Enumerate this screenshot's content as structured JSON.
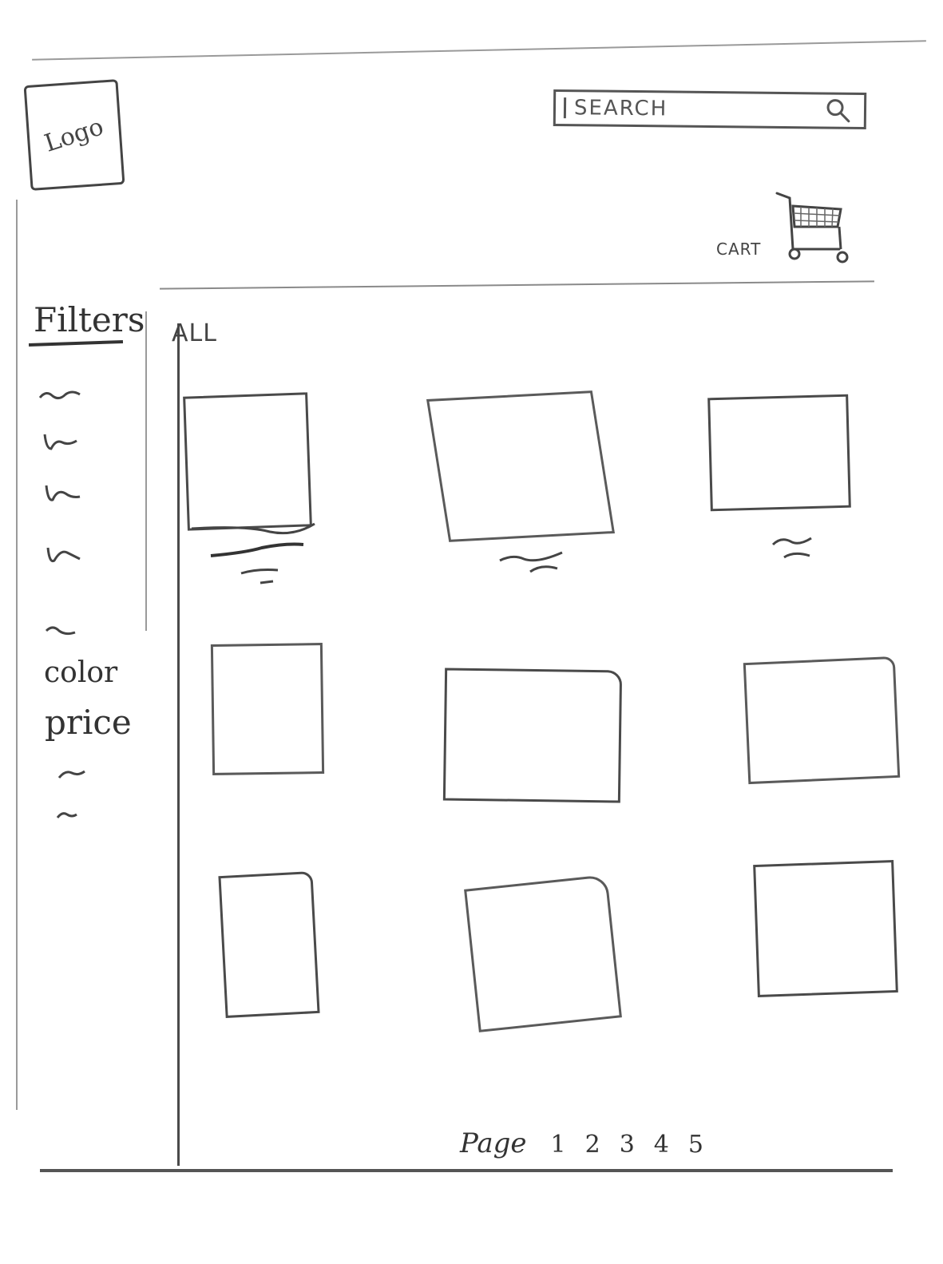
{
  "header": {
    "logo_text": "Logo",
    "search_placeholder": "SEARCH",
    "cart_label": "CART"
  },
  "sidebar": {
    "title": "Filters",
    "sections": [
      "color",
      "price"
    ]
  },
  "main": {
    "active_tab": "ALL",
    "product_count": 9
  },
  "pagination": {
    "label": "Page",
    "pages": [
      "1",
      "2",
      "3",
      "4",
      "5"
    ]
  },
  "icons": {
    "search": "search-icon",
    "cart": "cart-icon"
  }
}
